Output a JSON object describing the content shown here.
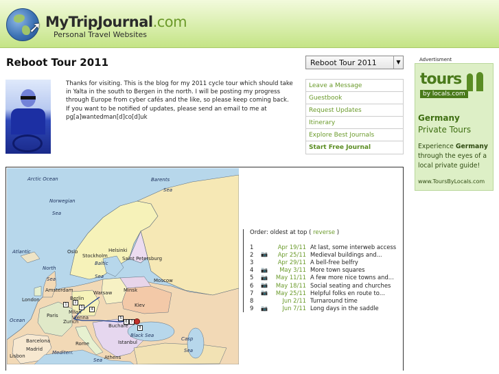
{
  "header": {
    "brand": "MyTripJournal",
    "brand_suffix": ".com",
    "tagline": "Personal Travel Websites",
    "logo_icon": "globe-cursor-icon"
  },
  "page_title": "Reboot Tour 2011",
  "journal_select": {
    "value": "Reboot Tour 2011"
  },
  "intro": {
    "paragraph1": "Thanks for visiting. This is the blog for my 2011 cycle tour which should take in Yalta in the south to Bergen in the north. I will be posting my progress through Europe from cyber cafés and the like, so please keep coming back.",
    "paragraph2": "If you want to be notified of updates, please send an email to me at pg[a]wantedman[d]co[d]uk"
  },
  "links": [
    "Leave a Message",
    "Guestbook",
    "Request Updates",
    "Itinerary",
    "Explore Best Journals",
    "Start Free Journal"
  ],
  "ad": {
    "label": "Advertisment",
    "logo_tours": "tours",
    "logo_bylocals": "by locals.com",
    "country": "Germany",
    "subtitle": "Private Tours",
    "body_pre": "Experience ",
    "body_bold": "Germany",
    "body_post": " through the eyes of a local private guide!",
    "url": "www.ToursByLocals.com"
  },
  "map": {
    "labels": {
      "arctic": "Arctic Ocean",
      "barents": "Barents",
      "sea1": "Sea",
      "norwegian": "Norwegian",
      "sea2": "Sea",
      "atlantic": "Atlantic",
      "north": "North",
      "sea3": "Sea",
      "baltic": "Baltic",
      "sea4": "Sea",
      "ocean": "Ocean",
      "black": "Black Sea",
      "casp": "Casp",
      "sea5": "Sea",
      "mediterr": "Mediterr.",
      "sea6": "Sea"
    },
    "cities": {
      "oslo": "Oslo",
      "stockholm": "Stockholm",
      "helsinki": "Helsinki",
      "stpetersburg": "Saint Petersburg",
      "moscow": "Moscow",
      "london": "London",
      "amsterdam": "Amsterdam",
      "berlin": "Berlin",
      "warsaw": "Warsaw",
      "minsk": "Minsk",
      "kiev": "Kiev",
      "paris": "Paris",
      "milan": "Milan",
      "vienna": "Vienna",
      "zurich": "Zurich",
      "bucharest": "Buchare",
      "istanbul": "Istanbul",
      "barcelona": "Barcelona",
      "madrid": "Madrid",
      "lisbon": "Lisbon",
      "rome": "Rome",
      "athens": "Athens"
    },
    "markers": [
      "1",
      "2",
      "3",
      "4",
      "5",
      "6",
      "7",
      "8"
    ]
  },
  "entries": {
    "order_prefix": "Order: oldest at top (",
    "order_link": "reverse",
    "order_suffix": ")",
    "items": [
      {
        "n": "1",
        "photo": false,
        "date": "Apr 19/11",
        "title": "At last, some interweb access"
      },
      {
        "n": "2",
        "photo": true,
        "date": "Apr 25/11",
        "title": "Medieval buildings and..."
      },
      {
        "n": "3",
        "photo": false,
        "date": "Apr 29/11",
        "title": "A bell-free belfry"
      },
      {
        "n": "4",
        "photo": true,
        "date": "May 3/11",
        "title": "More town squares"
      },
      {
        "n": "5",
        "photo": true,
        "date": "May 11/11",
        "title": "A few more nice towns and..."
      },
      {
        "n": "6",
        "photo": true,
        "date": "May 18/11",
        "title": "Social seating and churches"
      },
      {
        "n": "7",
        "photo": true,
        "date": "May 25/11",
        "title": "Helpful folks en route to..."
      },
      {
        "n": "8",
        "photo": false,
        "date": "Jun 2/11",
        "title": "Turnaround time"
      },
      {
        "n": "9",
        "photo": true,
        "date": "Jun 7/11",
        "title": "Long days in the saddle"
      }
    ]
  }
}
